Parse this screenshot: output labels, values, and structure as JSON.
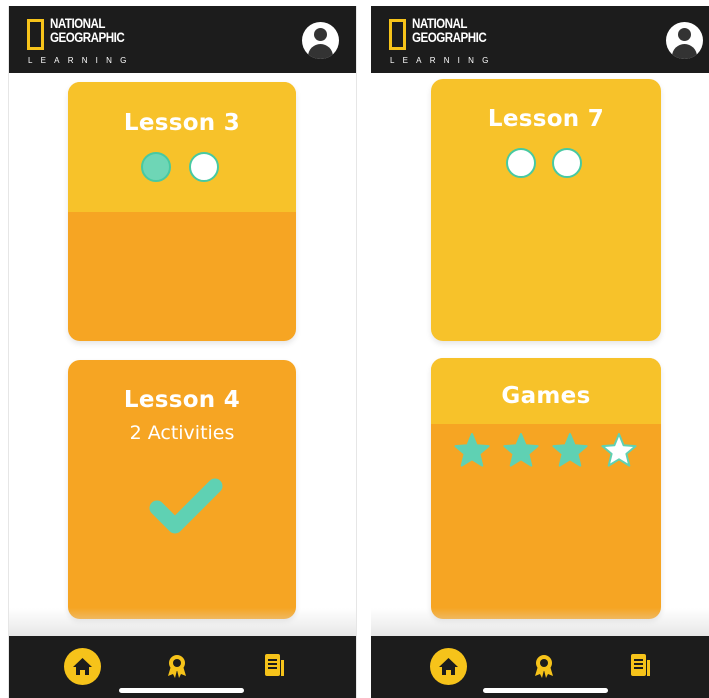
{
  "brand": {
    "name_line1": "NATIONAL",
    "name_line2": "GEOGRAPHIC",
    "sub": "LEARNING"
  },
  "left_screen": {
    "cards": [
      {
        "title": "Lesson 3",
        "progress_dots": [
          "filled",
          "empty"
        ]
      },
      {
        "title": "Lesson 4",
        "subtitle": "2 Activities",
        "completed": true
      }
    ]
  },
  "right_screen": {
    "cards": [
      {
        "title": "Lesson 7",
        "progress_dots": [
          "empty",
          "empty"
        ]
      },
      {
        "title": "Games",
        "stars": {
          "earned": 3,
          "total": 4
        }
      }
    ]
  },
  "nav": {
    "items": [
      "home-icon",
      "award-icon",
      "book-icon"
    ],
    "active": "home"
  },
  "colors": {
    "header": "#1c1c1c",
    "brand_yellow": "#f6c31a",
    "card_top": "#f7c22a",
    "card_body": "#f6a523",
    "teal": "#5fd1b3"
  }
}
